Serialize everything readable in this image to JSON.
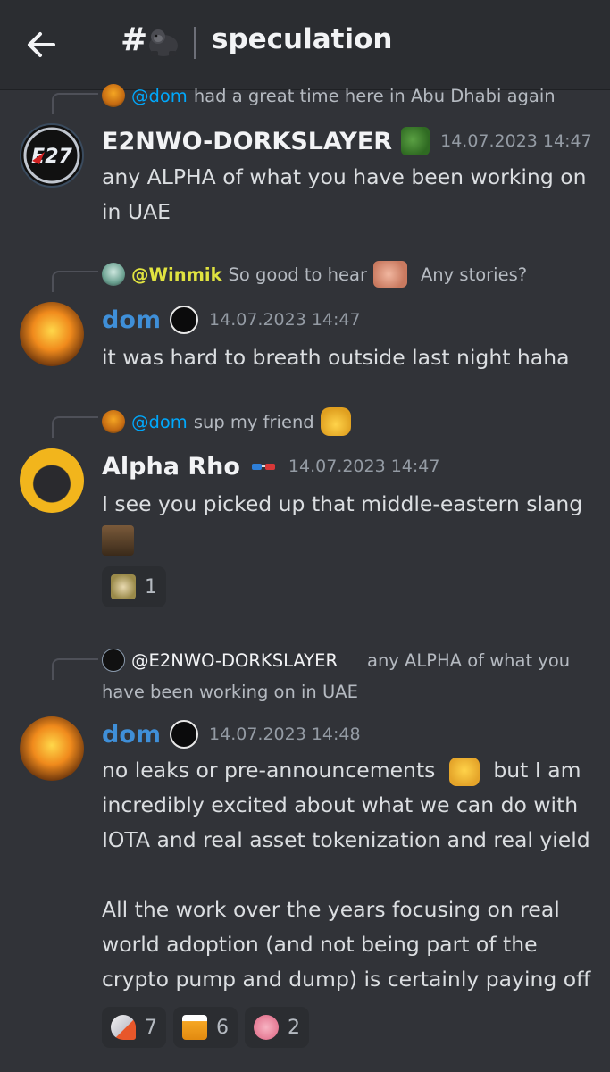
{
  "header": {
    "hash": "#",
    "divider": "|",
    "channel": "speculation"
  },
  "messages": [
    {
      "reply": {
        "mention": "@dom",
        "text": "had a great time here in Abu Dhabi again"
      },
      "author": "E2NWO-DORKSLAYER",
      "author_color": "#f2f3f5",
      "timestamp": "14.07.2023 14:47",
      "content": "any ALPHA of what you have been working on in UAE"
    },
    {
      "reply": {
        "mention": "@Winmik",
        "text": "So good to hear",
        "text2": "Any stories?"
      },
      "author": "dom",
      "author_color": "#3f8fd8",
      "timestamp": "14.07.2023 14:47",
      "content": "it was hard to breath outside last night haha"
    },
    {
      "reply": {
        "mention": "@dom",
        "text": "sup my friend"
      },
      "author": "Alpha Rho",
      "author_color": "#f2f3f5",
      "timestamp": "14.07.2023 14:47",
      "content": "I see you picked up that middle-eastern slang",
      "reactions": [
        {
          "emoji": "bird-emoji",
          "count": "1"
        }
      ]
    },
    {
      "reply": {
        "mention": "@E2NWO-DORKSLAYER",
        "text": "any ALPHA of what you have been working on in UAE"
      },
      "author": "dom",
      "author_color": "#3f8fd8",
      "timestamp": "14.07.2023 14:48",
      "content_1a": "no leaks or pre-announcements",
      "content_1b": "but I am incredibly excited about what we can do with IOTA and real asset tokenization and real yield",
      "content_2": "All the work over the years focusing on real world adoption (and not being part of the crypto pump and dump) is certainly paying off",
      "reactions": [
        {
          "emoji": "rocket-emoji",
          "count": "7"
        },
        {
          "emoji": "beer-emoji",
          "count": "6"
        },
        {
          "emoji": "brain-emoji",
          "count": "2"
        }
      ]
    }
  ]
}
